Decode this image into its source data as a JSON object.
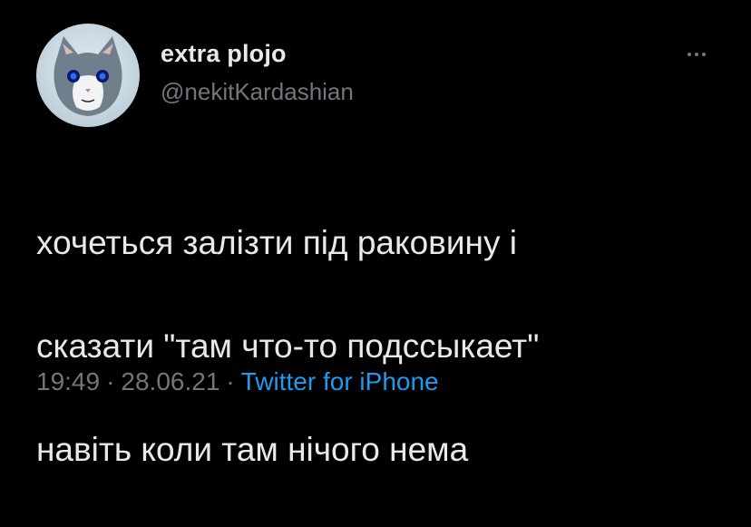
{
  "tweet": {
    "author": {
      "display_name": "extra plojo",
      "handle": "@nekitKardashian"
    },
    "text_lines": [
      "хочеться залізти під раковину і",
      "сказати \"там что-то подссыкает\"",
      "навіть коли там нічого нема"
    ],
    "time": "19:49",
    "date": "28.06.21",
    "separator": "·",
    "source": "Twitter for iPhone"
  },
  "colors": {
    "background": "#000000",
    "text": "#e7e9ea",
    "secondary": "#71767b",
    "link": "#1d9bf0"
  },
  "icons": {
    "more": "more-dots-icon"
  }
}
